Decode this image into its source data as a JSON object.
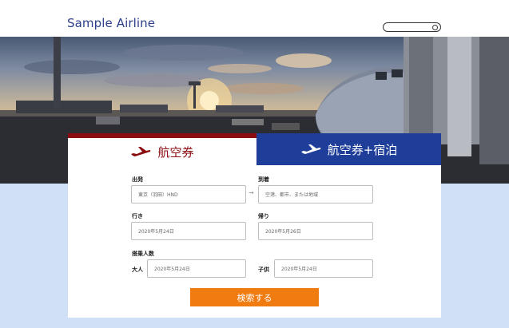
{
  "header": {
    "brand": "Sample Airline"
  },
  "tabs": [
    {
      "label": "航空券",
      "icon": "airplane-icon",
      "color": "#8b0d12"
    },
    {
      "label": "航空券+宿泊",
      "icon": "airplane-icon",
      "color": "#1e3e9a"
    }
  ],
  "form": {
    "departure": {
      "label": "出発",
      "value": "東京（羽田）HND"
    },
    "arrival": {
      "label": "到着",
      "placeholder": "空港、都市、または地域"
    },
    "outbound": {
      "label": "行き",
      "value": "2020年5月24日"
    },
    "return": {
      "label": "帰り",
      "value": "2020年5月26日"
    },
    "passengers": {
      "label": "搭乗人数",
      "adult_label": "大人",
      "adult_value": "2020年5月24日",
      "child_label": "子供",
      "child_value": "2020年5月24日"
    },
    "search_button": "検索する"
  },
  "colors": {
    "brand": "#2b3f8a",
    "accent_red": "#8b0d12",
    "accent_blue": "#1e3e9a",
    "button": "#f07b11",
    "background": "#cfe0f7"
  }
}
